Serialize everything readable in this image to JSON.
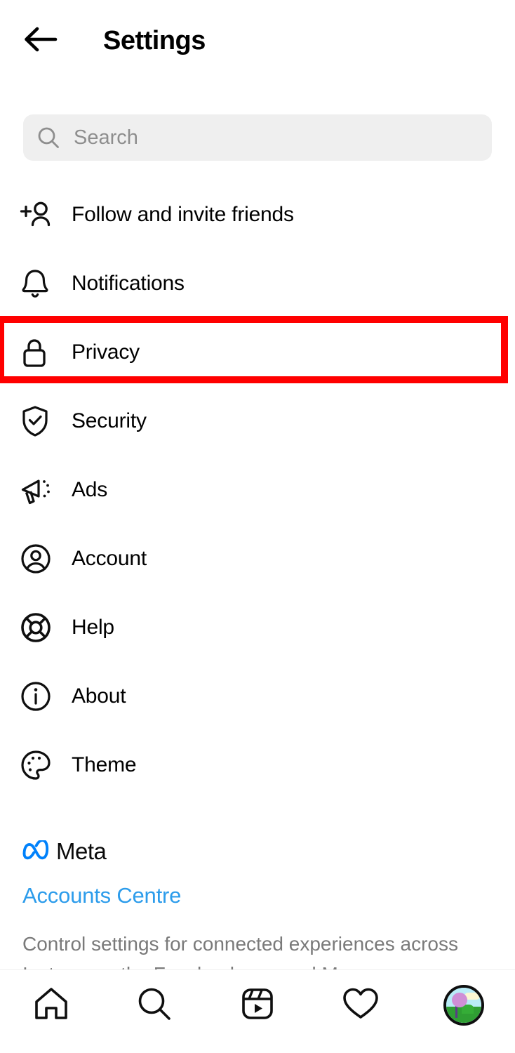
{
  "header": {
    "back_icon": "arrow-left-icon",
    "title": "Settings"
  },
  "search": {
    "icon": "search-icon",
    "placeholder": "Search",
    "value": ""
  },
  "settings_items": [
    {
      "label": "Follow and invite friends",
      "icon": "add-person-icon"
    },
    {
      "label": "Notifications",
      "icon": "bell-icon"
    },
    {
      "label": "Privacy",
      "icon": "lock-icon",
      "highlighted": true
    },
    {
      "label": "Security",
      "icon": "shield-check-icon"
    },
    {
      "label": "Ads",
      "icon": "megaphone-icon"
    },
    {
      "label": "Account",
      "icon": "person-circle-icon"
    },
    {
      "label": "Help",
      "icon": "life-ring-icon"
    },
    {
      "label": "About",
      "icon": "info-circle-icon"
    },
    {
      "label": "Theme",
      "icon": "palette-icon"
    }
  ],
  "highlight": {
    "color": "#ff0000",
    "target": "Privacy"
  },
  "meta_section": {
    "logo_icon": "meta-infinity-icon",
    "logo_color": "#0081fb",
    "wordmark": "Meta",
    "link_label": "Accounts Centre",
    "link_color": "#2c9ceb",
    "description": "Control settings for connected experiences across Instagram, the Facebook app and Messenger"
  },
  "bottom_nav": [
    {
      "icon": "home-icon",
      "label": "Home"
    },
    {
      "icon": "search-icon",
      "label": "Search"
    },
    {
      "icon": "reels-icon",
      "label": "Reels"
    },
    {
      "icon": "heart-icon",
      "label": "Activity"
    },
    {
      "icon": "profile-avatar-icon",
      "label": "Profile"
    }
  ]
}
